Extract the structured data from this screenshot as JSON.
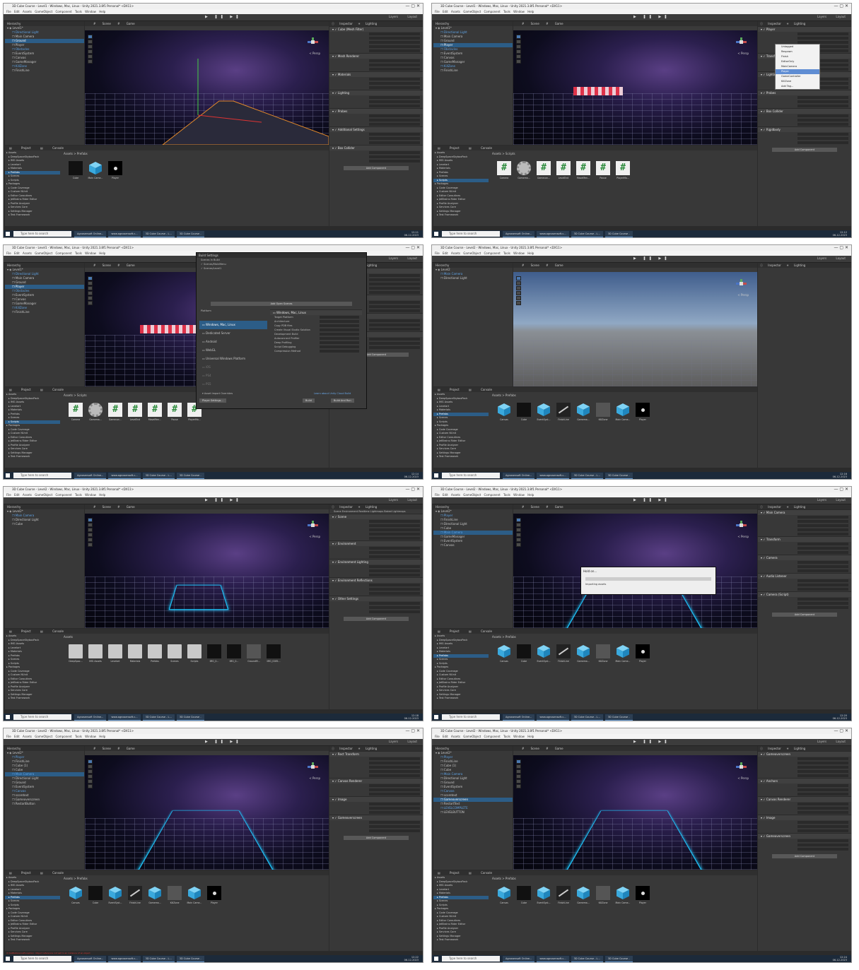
{
  "frames": [
    {
      "title": "3D Cube Course - Level1 - Windows, Mac, Linux - Unity 2021.3.8f1 Personal* <DX11>",
      "clock": [
        "12:11",
        "06-12-2023"
      ],
      "hierarchy": [
        "Level1*",
        "Directional Light",
        "Main Camera",
        "Ground",
        "Player",
        "Obstacles",
        "EventSystem",
        "Canvas",
        "GameManager",
        "KillZone",
        "FinishLine"
      ],
      "selected": "Ground",
      "breadcrumb": "Assets > Prefabs",
      "assets": [
        "Cube",
        "Main Came...",
        "Player"
      ],
      "inspector": [
        "Cube (Mesh Filter)",
        "Mesh Renderer",
        "Materials",
        "Lighting",
        "Probes",
        "Additional Settings",
        "Box Collider"
      ]
    },
    {
      "title": "3D Cube Course - Level1 - Windows, Mac, Linux - Unity 2021.3.8f1 Personal* <DX11>",
      "clock": [
        "12:12",
        "06-12-2023"
      ],
      "hierarchy": [
        "Level1*",
        "Directional Light",
        "Main Camera",
        "Ground",
        "Player",
        "Obstacles",
        "EventSystem",
        "Canvas",
        "GameManager",
        "KillZone",
        "FinishLine"
      ],
      "selected": "Player",
      "breadcrumb": "Assets > Scripts",
      "assets": [
        "Camera",
        "Gamema...",
        "Gamecon...",
        "LevelEnd",
        "MoveMen...",
        "Pause",
        "PlayerMo..."
      ],
      "inspector": [
        "Player",
        "Transform",
        "Lighting",
        "Probes",
        "Box Collider",
        "Rigidbody"
      ],
      "dropdown": [
        "Untagged",
        "Respawn",
        "Finish",
        "EditorOnly",
        "MainCamera",
        "Player",
        "GameController",
        "KillZone",
        "Add Tag..."
      ]
    },
    {
      "title": "3D Cube Course - Level1 - Windows, Mac, Linux - Unity 2021.3.8f1 Personal* <DX11>",
      "clock": [
        "12:14",
        "06-12-2023"
      ],
      "hierarchy": [
        "Level1*",
        "Directional Light",
        "Main Camera",
        "Ground",
        "Player",
        "Obstacles",
        "EventSystem",
        "Canvas",
        "GameManager",
        "KillZone",
        "FinishLine"
      ],
      "selected": "Player",
      "breadcrumb": "Assets > Scripts",
      "assets": [
        "Camera",
        "Gamema...",
        "Gamecon...",
        "LevelEnd",
        "MoveMen...",
        "Pause",
        "PlayerMo..."
      ],
      "inspector": [
        "Player",
        "Transform",
        "Box Collider",
        "Rigidbody"
      ],
      "build": {
        "title": "Build Settings",
        "scenes_label": "Scenes In Build",
        "scenes": [
          "Scenes/MainMenu",
          "Scenes/Level1"
        ],
        "platform_label": "Platform",
        "platforms": [
          "Windows, Mac, Linux",
          "Dedicated Server",
          "Android",
          "WebGL",
          "Universal Windows Platform",
          "iOS",
          "PS4",
          "PS5"
        ],
        "right_title": "Windows, Mac, Linux",
        "options": [
          "Target Platform",
          "Architecture",
          "Copy PDB files",
          "Create Visual Studio Solution",
          "Development Build",
          "Autoconnect Profiler",
          "Deep Profiling",
          "Script Debugging",
          "Compression Method"
        ],
        "buttons": [
          "Add Open Scenes",
          "Player Settings...",
          "Build",
          "Build And Run"
        ],
        "link": "Learn about Unity Cloud Build",
        "asset_import": "Asset Import Overrides"
      }
    },
    {
      "title": "3D Cube Course - Level2 - Windows, Mac, Linux - Unity 2021.3.8f1 Personal* <DX11>",
      "clock": [
        "12:16",
        "06-12-2023"
      ],
      "hierarchy": [
        "Level2",
        "Main Camera",
        "Directional Light"
      ],
      "selected": "",
      "breadcrumb": "Assets > Prefabs",
      "assets": [
        "Canvas",
        "Cube",
        "EventSyst...",
        "FinishLine",
        "Gamema...",
        "KillZone",
        "Main Came...",
        "Player"
      ],
      "inspector": []
    },
    {
      "title": "3D Cube Course - Level2 - Windows, Mac, Linux - Unity 2021.3.8f1 Personal* <DX11>",
      "clock": [
        "12:18",
        "06-12-2023"
      ],
      "hierarchy": [
        "Level2*",
        "Main Camera",
        "Directional Light",
        "Cube"
      ],
      "selected": "",
      "breadcrumb": "Assets",
      "assets": [
        "DeepSpac...",
        "IMG Assets",
        "Levelart",
        "Materials",
        "Prefabs",
        "Scenes",
        "Scripts",
        "IMG_0...",
        "IMG_0...",
        "GroundM...",
        "IMG_0285..."
      ],
      "inspector": [
        "Scene",
        "Environment",
        "Environment Lighting",
        "Environment Reflections",
        "Other Settings"
      ],
      "lighting_tabs": "Scene  Environment  Realtime Lightmaps  Baked Lightmaps"
    },
    {
      "title": "3D Cube Course - Level2 - Windows, Mac, Linux - Unity 2021.3.8f1 Personal* <DX11>",
      "clock": [
        "12:20",
        "06-12-2023"
      ],
      "hierarchy": [
        "Level2*",
        "Player",
        "FinishLine",
        "Directional Light",
        "Cube",
        "Main Camera",
        "GameManager",
        "EventSystem",
        "Canvas"
      ],
      "selected": "Main Camera",
      "breadcrumb": "Assets > Prefabs",
      "assets": [
        "Canvas",
        "Cube",
        "EventSyst...",
        "FinishLine",
        "Gamema...",
        "KillZone",
        "Main Came...",
        "Player"
      ],
      "inspector": [
        "Main Camera",
        "Transform",
        "Camera",
        "Audio Listener",
        "Camera (Script)"
      ],
      "import_dialog": [
        "Hold on...",
        "Importing assets"
      ]
    },
    {
      "title": "3D Cube Course - Level2 - Windows, Mac, Linux - Unity 2021.3.8f1 Personal* <DX11>",
      "clock": [
        "12:22",
        "06-12-2023"
      ],
      "hierarchy": [
        "Level2*",
        "Player",
        "FinishLine",
        "Cube (1)",
        "Cube",
        "Main Camera",
        "Directional Light",
        "Ground",
        "EventSystem",
        "Canvas",
        "scoretext",
        "Gameoverscreen",
        "RestartButton"
      ],
      "selected": "Main Camera",
      "breadcrumb": "Assets > Prefabs",
      "assets": [
        "Canvas",
        "Cube",
        "EventSyst...",
        "FinishLine",
        "Gamema...",
        "KillZone",
        "Main Came...",
        "Player"
      ],
      "inspector": [
        "Rect Transform",
        "Canvas Renderer",
        "Image",
        "Gameoverscreen"
      ],
      "status": "NullReferenceException: Object reference not set to an instance of an object"
    },
    {
      "title": "3D Cube Course - Level2 - Windows, Mac, Linux - Unity 2021.3.8f1 Personal* <DX11>",
      "clock": [
        "12:24",
        "06-12-2023"
      ],
      "hierarchy": [
        "Level2*",
        "Player",
        "FinishLine",
        "Cube (1)",
        "Cube",
        "Main Camera",
        "Directional Light",
        "Ground",
        "EventSystem",
        "Canvas",
        "scoretext",
        "Gameoverscreen",
        "RestartText",
        "LEVELCOMPLETE",
        "LEVELBUTTON"
      ],
      "selected": "Gameoverscreen",
      "breadcrumb": "Assets > Prefabs",
      "assets": [
        "Canvas",
        "Cube",
        "EventSyst...",
        "FinishLine",
        "Gamema...",
        "KillZone",
        "Main Came...",
        "Player"
      ],
      "inspector": [
        "Gameoverscreen",
        "Anchors",
        "Canvas Renderer",
        "Image",
        "Gameoverscreen"
      ]
    }
  ],
  "common": {
    "menu": [
      "File",
      "Edit",
      "Assets",
      "GameObject",
      "Component",
      "Tools",
      "Window",
      "Help"
    ],
    "scene_tabs": [
      "Scene",
      "Game"
    ],
    "hierarchy_title": "Hierarchy",
    "inspector_tabs": [
      "Inspector",
      "Lighting"
    ],
    "project_tabs": [
      "Project",
      "Console"
    ],
    "layers": [
      "Layers",
      "Layout"
    ],
    "persp": "< Persp",
    "add_component": "Add Component",
    "taskbar_search": "Type here to search",
    "taskbar_apps": [
      "Agnosensoft Online...",
      "www.agnosensoft.c...",
      "3D Cube Course - L...",
      "3D Cube Course -"
    ],
    "project_tree": [
      "Assets",
      "DeepSpaceSkyboxPack",
      "IMG Assets",
      "Levelart",
      "Materials",
      "Prefabs",
      "Scenes",
      "Scripts",
      "Packages",
      "Code Coverage",
      "Custom NUnit",
      "Editor Coroutines",
      "JetBrains Rider Editor",
      "Profile Analyzer",
      "Services Core",
      "Settings Manager",
      "Test Framework"
    ]
  }
}
